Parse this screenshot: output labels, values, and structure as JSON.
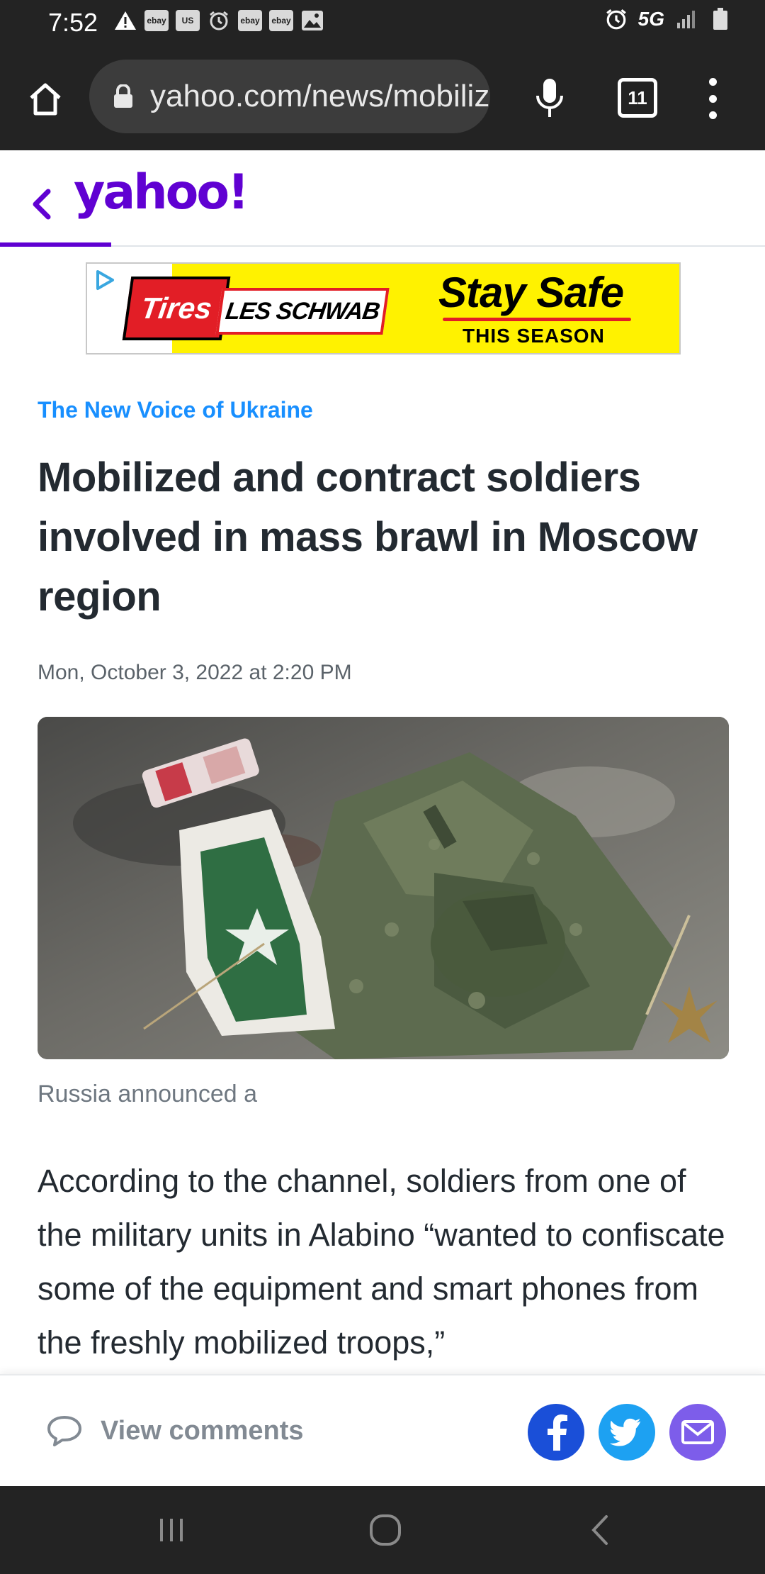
{
  "status_bar": {
    "time": "7:52",
    "notification_icons": [
      "warning-icon",
      "ebay-icon",
      "us-icon",
      "alarm-icon",
      "ebay-icon",
      "ebay-icon",
      "image-icon"
    ],
    "left_badges": [
      "ebay",
      "US",
      "ebay",
      "ebay"
    ],
    "network": "5G",
    "right_icons": [
      "alarm-icon",
      "signal-icon",
      "battery-icon"
    ]
  },
  "browser": {
    "url": "yahoo.com/news/mobilized-contract-soldiers-involved-mass",
    "tab_count": "11",
    "icons": [
      "home-icon",
      "lock-icon",
      "mic-icon",
      "tabs-icon",
      "more-vert-icon"
    ]
  },
  "site": {
    "logo": "yahoo!",
    "back_icon": "chevron-left-icon",
    "brand_color": "#6001d2"
  },
  "ad": {
    "brand_left": "Tires",
    "brand_right": "LES SCHWAB",
    "headline": "Stay Safe",
    "subline": "THIS SEASON",
    "background_color": "#fff200",
    "accent_color": "#e21e26"
  },
  "article": {
    "provider": "The New Voice of Ukraine",
    "provider_color": "#188fff",
    "headline": "Mobilized and contract soldiers involved in mass brawl in Moscow region",
    "timestamp": "Mon, October 3, 2022 at 2:20 PM",
    "image_description_icon": "photo",
    "caption": "Russia announced a",
    "body": "According to the channel, soldiers from one of the military units in Alabino “wanted to confiscate some of the equipment and smart phones from the freshly mobilized troops,”"
  },
  "action_bar": {
    "comments_label": "View comments",
    "share_buttons": [
      {
        "name": "facebook",
        "color": "#1a4fd8"
      },
      {
        "name": "twitter",
        "color": "#1da1f2"
      },
      {
        "name": "email",
        "color": "#7d5dea"
      }
    ]
  },
  "nav_bar": {
    "buttons": [
      "recent-apps",
      "home",
      "back"
    ]
  }
}
